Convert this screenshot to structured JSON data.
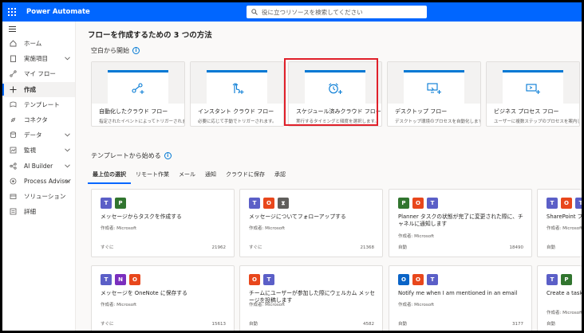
{
  "app": {
    "title": "Power Automate"
  },
  "search": {
    "placeholder": "役に立つリソースを検索してください"
  },
  "sidebar": {
    "items": [
      {
        "label": "ホーム",
        "icon": "home-icon"
      },
      {
        "label": "実施項目",
        "icon": "clipboard-icon",
        "chevron": true
      },
      {
        "label": "マイ フロー",
        "icon": "flow-icon"
      },
      {
        "label": "作成",
        "icon": "plus-icon",
        "active": true
      },
      {
        "label": "テンプレート",
        "icon": "template-icon"
      },
      {
        "label": "コネクタ",
        "icon": "connector-icon"
      },
      {
        "label": "データ",
        "icon": "database-icon",
        "chevron": true
      },
      {
        "label": "監視",
        "icon": "monitor-icon",
        "chevron": true
      },
      {
        "label": "AI Builder",
        "icon": "ai-icon",
        "chevron": true
      },
      {
        "label": "Process Advisor",
        "icon": "process-icon",
        "chevron": true
      },
      {
        "label": "ソリューション",
        "icon": "solution-icon"
      },
      {
        "label": "詳細",
        "icon": "more-icon"
      }
    ]
  },
  "main": {
    "title": "フローを作成するための 3 つの方法",
    "blank_section": "空白から開始",
    "create_cards": [
      {
        "title": "自動化したクラウド フロー",
        "desc": "指定されたイベントによってトリガーされます。",
        "icon": "automated-flow-icon"
      },
      {
        "title": "インスタント クラウド フロー",
        "desc": "必要に応じて手動でトリガーされます。",
        "icon": "instant-flow-icon"
      },
      {
        "title": "スケジュール済みクラウド フロー",
        "desc": "実行するタイミングと頻度を選択します。",
        "icon": "alarm-clock-icon"
      },
      {
        "title": "デスクトップ フロー",
        "desc": "デスクトップ環境のプロセスを自動化します。",
        "icon": "desktop-flow-icon"
      },
      {
        "title": "ビジネス プロセス フロー",
        "desc": "ユーザーに複数ステップのプロセスを案内します",
        "icon": "business-flow-icon"
      }
    ],
    "template_section": "テンプレートから始める",
    "tabs": [
      "最上位の選択",
      "リモート作業",
      "メール",
      "通知",
      "クラウドに保存",
      "承認"
    ],
    "templates": [
      {
        "title": "メッセージからタスクを作成する",
        "author": "作成者: Microsoft",
        "type": "すぐに",
        "count": "21962",
        "icons": [
          "teams",
          "planner"
        ]
      },
      {
        "title": "メッセージについてフォローアップする",
        "author": "作成者: Microsoft",
        "type": "すぐに",
        "count": "21368",
        "icons": [
          "teams",
          "office",
          "schedule"
        ]
      },
      {
        "title": "Planner タスクの状態が完了に変更された際に、チャネルに通知します",
        "author": "作成者: Microsoft",
        "type": "自動",
        "count": "18490",
        "icons": [
          "planner",
          "office",
          "teams"
        ]
      },
      {
        "title": "SharePoint フォルダ...",
        "author": "作成者: Microsoft",
        "type": "自動",
        "count": "",
        "icons": [
          "teams",
          "office",
          "teams"
        ]
      },
      {
        "title": "メッセージを OneNote に保存する",
        "author": "作成者: Microsoft",
        "type": "すぐに",
        "count": "15613",
        "icons": [
          "teams",
          "onenote",
          "office"
        ]
      },
      {
        "title": "チームにユーザーが参加した際にウェルカム メッセージを投稿します",
        "author": "作成者: Microsoft",
        "type": "自動",
        "count": "4582",
        "icons": [
          "office",
          "teams"
        ]
      },
      {
        "title": "Notify me when I am mentioned in an email",
        "author": "作成者: Microsoft",
        "type": "自動",
        "count": "3177",
        "icons": [
          "outlook",
          "office",
          "teams"
        ]
      },
      {
        "title": "Create a task in Pl... in a channel",
        "author": "作成者: Microsoft",
        "type": "自動",
        "count": "",
        "icons": [
          "teams",
          "planner"
        ]
      }
    ]
  }
}
